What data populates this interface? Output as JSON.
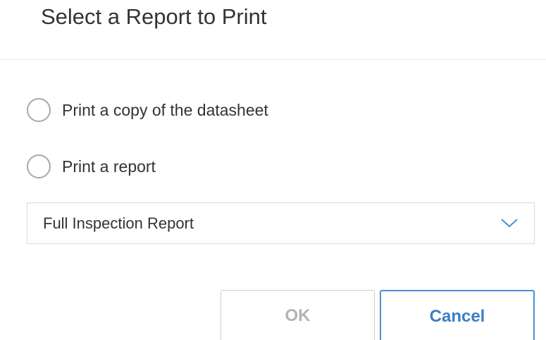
{
  "dialog": {
    "title": "Select a Report to Print"
  },
  "options": [
    {
      "label": "Print a copy of the datasheet",
      "selected": false
    },
    {
      "label": "Print a report",
      "selected": false
    }
  ],
  "report_select": {
    "value": "Full Inspection Report",
    "icon": "chevron-down-icon"
  },
  "buttons": {
    "ok_label": "OK",
    "ok_disabled": true,
    "cancel_label": "Cancel"
  },
  "colors": {
    "accent": "#3a7fc4",
    "disabled_text": "#b3b3b3",
    "text": "#333333"
  }
}
